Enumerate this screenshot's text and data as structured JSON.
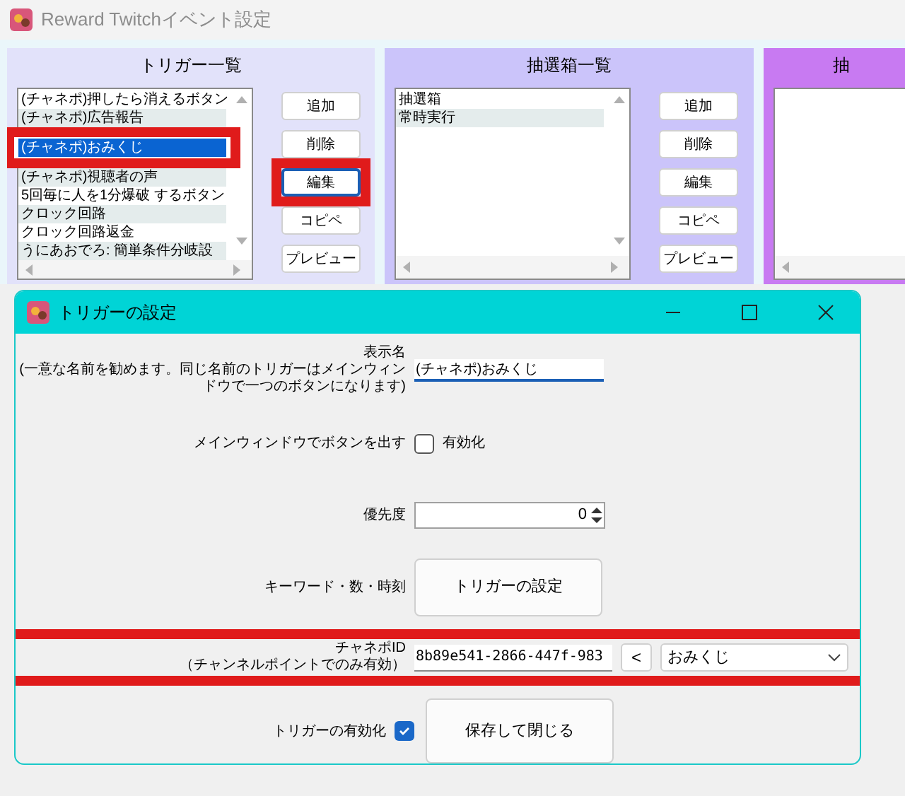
{
  "window": {
    "title": "Reward Twitchイベント設定"
  },
  "panels": [
    {
      "title": "トリガー一覧",
      "color": "#e2e2fa",
      "items": [
        {
          "text": "(チャネポ)押したら消えるボタン",
          "selected": false,
          "annotated": false
        },
        {
          "text": "(チャネポ)広告報告",
          "selected": false,
          "annotated": false
        },
        {
          "text": "(チャネポ)おみくじ",
          "selected": true,
          "annotated": true
        },
        {
          "text": "(チャネポ)視聴者の声",
          "selected": false,
          "annotated": false
        },
        {
          "text": "5回毎に人を1分爆破 するボタン",
          "selected": false,
          "annotated": false
        },
        {
          "text": "クロック回路",
          "selected": false,
          "annotated": false
        },
        {
          "text": "クロック回路返金",
          "selected": false,
          "annotated": false
        },
        {
          "text": "うにあおでろ: 簡単条件分岐設",
          "selected": false,
          "annotated": false
        }
      ],
      "buttons": [
        {
          "label": "追加",
          "annotated": false
        },
        {
          "label": "削除",
          "annotated": false
        },
        {
          "label": "編集",
          "annotated": true
        },
        {
          "label": "コピペ",
          "annotated": false
        },
        {
          "label": "プレビュー",
          "annotated": false
        }
      ]
    },
    {
      "title": "抽選箱一覧",
      "color": "#cbc4fa",
      "items": [
        {
          "text": "抽選箱",
          "selected": false,
          "annotated": false
        },
        {
          "text": "常時実行",
          "selected": false,
          "annotated": false
        }
      ],
      "buttons": [
        {
          "label": "追加",
          "annotated": false
        },
        {
          "label": "削除",
          "annotated": false
        },
        {
          "label": "編集",
          "annotated": false
        },
        {
          "label": "コピペ",
          "annotated": false
        },
        {
          "label": "プレビュー",
          "annotated": false
        }
      ]
    },
    {
      "title": "抽",
      "color": "#c87af2"
    }
  ],
  "dialog": {
    "title": "トリガーの設定",
    "rows": [
      {
        "kind": "text",
        "label_lines": [
          "表示名",
          "(一意な名前を勧めます。同じ名前のトリガーはメインウィン",
          "ドウで一つのボタンになります)"
        ],
        "value": "(チャネポ)おみくじ",
        "annotated": false
      },
      {
        "kind": "checkbox",
        "label_lines": [
          "メインウィンドウでボタンを出す"
        ],
        "checkbox_label": "有効化",
        "checked": false,
        "annotated": false
      },
      {
        "kind": "spin",
        "label_lines": [
          "優先度"
        ],
        "value": "0",
        "annotated": false
      },
      {
        "kind": "button",
        "label_lines": [
          "キーワード・数・時刻"
        ],
        "button_label": "トリガーの設定",
        "annotated": false
      },
      {
        "kind": "channel",
        "label_lines": [
          "チャネポID",
          "（チャンネルポイントでのみ有効）"
        ],
        "value": "8b89e541-2866-447f-983",
        "arrow_label": "<",
        "select_value": "おみくじ",
        "annotated": true
      },
      {
        "kind": "enable",
        "label_lines": [
          "トリガーの有効化"
        ],
        "checked": true,
        "button_label": "保存して閉じる",
        "annotated": false
      }
    ]
  }
}
